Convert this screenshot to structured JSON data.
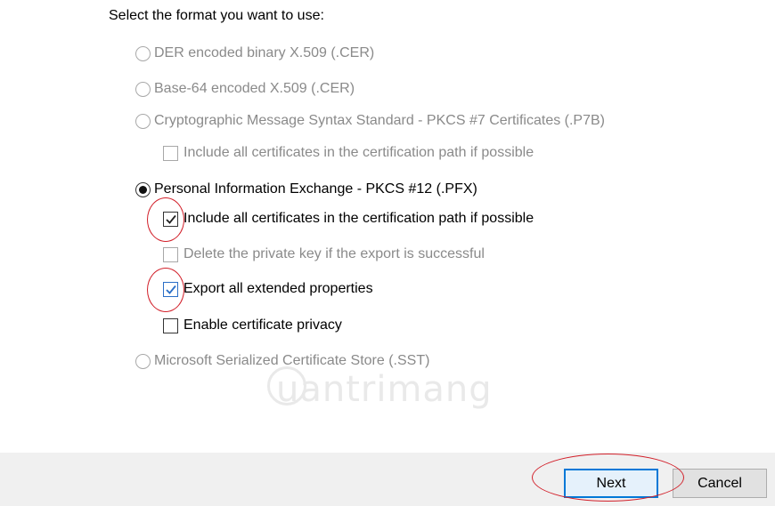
{
  "heading": "Select the format you want to use:",
  "options": {
    "der": "DER encoded binary X.509 (.CER)",
    "base64": "Base-64 encoded X.509 (.CER)",
    "pkcs7": "Cryptographic Message Syntax Standard - PKCS #7 Certificates (.P7B)",
    "pkcs7_include": "Include all certificates in the certification path if possible",
    "pfx": "Personal Information Exchange - PKCS #12 (.PFX)",
    "pfx_include": "Include all certificates in the certification path if possible",
    "pfx_delete_key": "Delete the private key if the export is successful",
    "pfx_export_ext": "Export all extended properties",
    "pfx_privacy": "Enable certificate privacy",
    "sst": "Microsoft Serialized Certificate Store (.SST)"
  },
  "watermark": "uantrimang",
  "buttons": {
    "next": "Next",
    "cancel": "Cancel"
  },
  "colors": {
    "annotation_red": "#d2202a",
    "focus_blue": "#0078d7"
  }
}
